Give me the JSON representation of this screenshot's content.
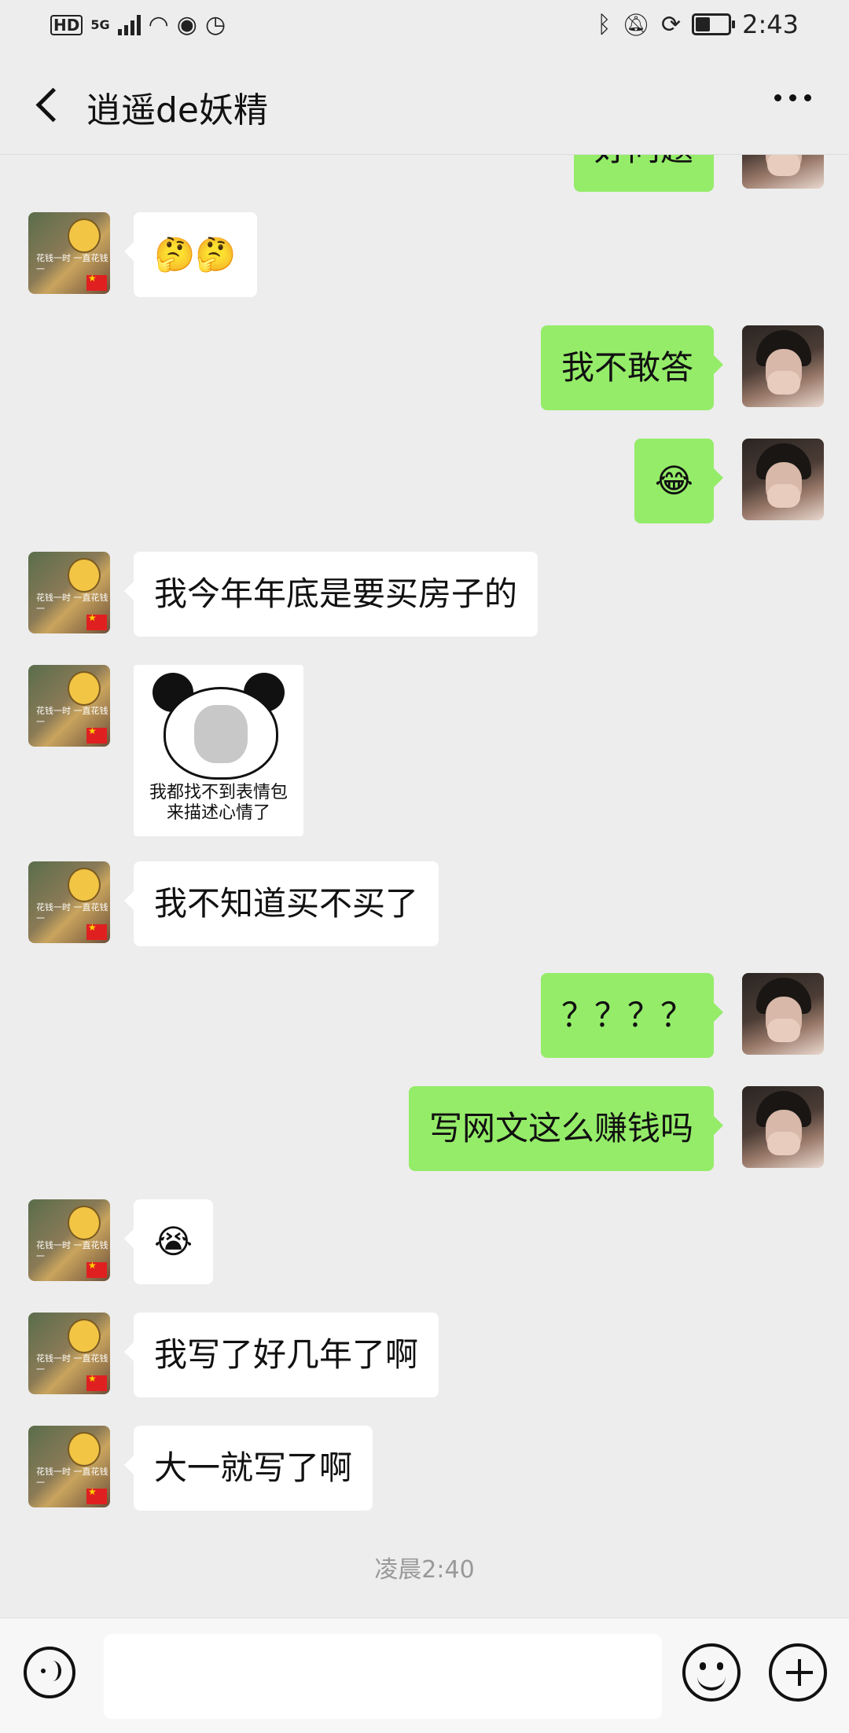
{
  "status_bar": {
    "network_badge": "HD",
    "network_type": "5G",
    "time": "2:43",
    "icons": [
      "hd-icon",
      "signal-icon",
      "wifi-icon",
      "eye-icon",
      "alarm-icon",
      "bluetooth-icon",
      "mute-icon",
      "rotation-icon",
      "battery-icon"
    ],
    "battery_level": 0.45
  },
  "nav": {
    "title": "逍遥de妖精",
    "back_icon": "chevron-left-icon",
    "more_icon": "more-dots-icon"
  },
  "messages": [
    {
      "side": "right",
      "type": "text",
      "text": "好问题",
      "partial": true
    },
    {
      "side": "left",
      "type": "emoji",
      "text": "🤔🤔"
    },
    {
      "side": "right",
      "type": "text",
      "text": "我不敢答"
    },
    {
      "side": "right",
      "type": "emoji",
      "text": "😂"
    },
    {
      "side": "left",
      "type": "text",
      "text": "我今年年底是要买房子的"
    },
    {
      "side": "left",
      "type": "sticker",
      "caption_line1": "我都找不到表情包",
      "caption_line2": "来描述心情了"
    },
    {
      "side": "left",
      "type": "text",
      "text": "我不知道买不买了"
    },
    {
      "side": "right",
      "type": "text",
      "text": "？？？？"
    },
    {
      "side": "right",
      "type": "text",
      "text": "写网文这么赚钱吗"
    },
    {
      "side": "left",
      "type": "emoji",
      "text": "😭"
    },
    {
      "side": "left",
      "type": "text",
      "text": "我写了好几年了啊"
    },
    {
      "side": "left",
      "type": "text",
      "text": "大一就写了啊"
    }
  ],
  "avatar_left": {
    "caption": "花钱一时 一直花钱一"
  },
  "timestamp": "凌晨2:40",
  "input_bar": {
    "voice_icon": "voice-icon",
    "emoji_icon": "emoji-icon",
    "plus_icon": "plus-icon",
    "input_value": ""
  }
}
